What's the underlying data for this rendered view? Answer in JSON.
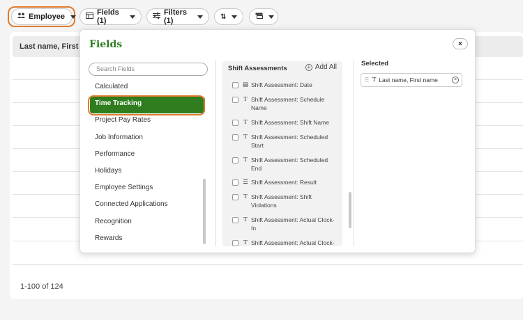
{
  "toolbar": {
    "employee_label": "Employee",
    "fields_label": "Fields (1)",
    "filters_label": "Filters (1)"
  },
  "table": {
    "first_column_header": "Last name, First nam",
    "pagination": "1-100 of 124"
  },
  "fields_panel": {
    "title": "Fields",
    "close_label": "×",
    "search_placeholder": "Search Fields",
    "categories": [
      {
        "label": "Calculated"
      },
      {
        "label": "Time Tracking"
      },
      {
        "label": "Project Pay Rates"
      },
      {
        "label": "Job Information"
      },
      {
        "label": "Performance"
      },
      {
        "label": "Holidays"
      },
      {
        "label": "Employee Settings"
      },
      {
        "label": "Connected Applications"
      },
      {
        "label": "Recognition"
      },
      {
        "label": "Rewards"
      }
    ],
    "selected_category": "Time Tracking",
    "group": {
      "title": "Shift Assessments",
      "add_all_label": "Add All",
      "fields": [
        {
          "label": "Shift Assessment: Date",
          "type_icon": "calendar-icon"
        },
        {
          "label": "Shift Assessment: Schedule Name",
          "type_icon": "text-type-icon"
        },
        {
          "label": "Shift Assessment: Shift Name",
          "type_icon": "text-type-icon"
        },
        {
          "label": "Shift Assessment: Scheduled Start",
          "type_icon": "text-type-icon"
        },
        {
          "label": "Shift Assessment: Scheduled End",
          "type_icon": "text-type-icon"
        },
        {
          "label": "Shift Assessment: Result",
          "type_icon": "list-icon"
        },
        {
          "label": "Shift Assessment: Shift Violations",
          "type_icon": "text-type-icon"
        },
        {
          "label": "Shift Assessment: Actual Clock-In",
          "type_icon": "text-type-icon"
        },
        {
          "label": "Shift Assessment: Actual Clock-",
          "type_icon": "text-type-icon"
        }
      ]
    },
    "selected_header": "Selected",
    "selected_fields": [
      {
        "label": "Last name, First name"
      }
    ]
  },
  "colors": {
    "brand_green": "#2f7d1e",
    "highlight_orange": "#e07b2e"
  }
}
